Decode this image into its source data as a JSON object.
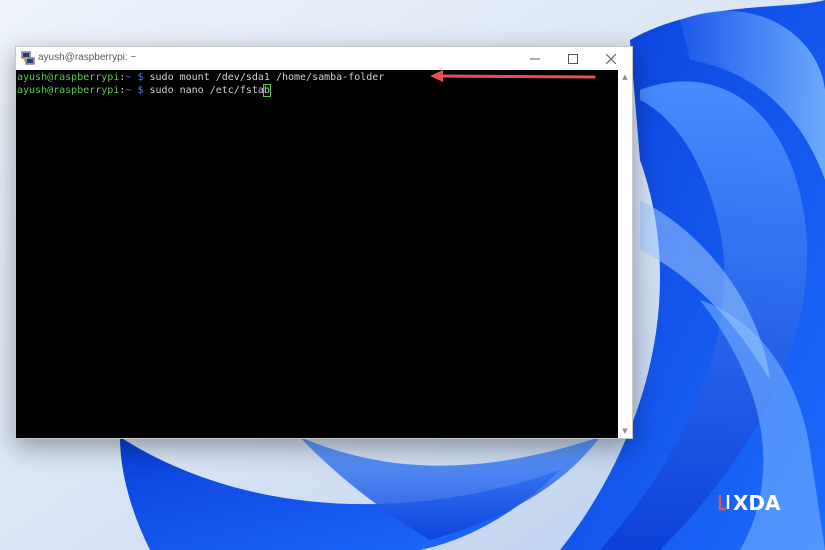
{
  "window": {
    "title": "ayush@raspberrypi: ~"
  },
  "terminal": {
    "lines": [
      {
        "user": "ayush@raspberrypi",
        "sep": ":",
        "path": "~",
        "prompt": "$",
        "command": "sudo mount /dev/sda1 /home/samba-folder"
      },
      {
        "user": "ayush@raspberrypi",
        "sep": ":",
        "path": "~",
        "prompt": "$",
        "command_before_cursor": "sudo nano /etc/fsta",
        "cursor_char": "b"
      }
    ]
  },
  "annotation": {
    "arrow_color": "#e5524f"
  },
  "watermark": {
    "text": "XDA"
  },
  "icons": {
    "app": "putty-icon",
    "minimize": "minimize-icon",
    "maximize": "maximize-icon",
    "close": "close-icon"
  }
}
